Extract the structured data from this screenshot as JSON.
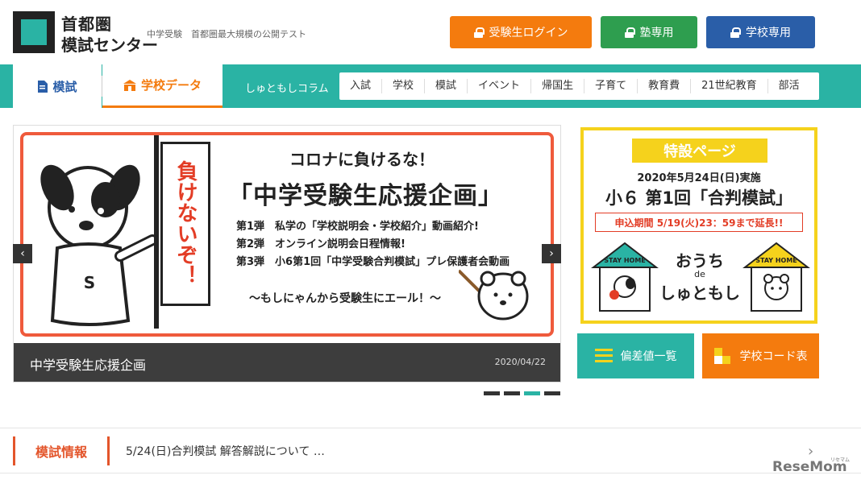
{
  "header": {
    "logo_line1": "首都圏",
    "logo_line2": "模試センター",
    "tagline": "中学受験　首都圏最大規模の公開テスト",
    "student_login": "受験生ログイン",
    "juku_only": "塾専用",
    "school_only": "学校専用"
  },
  "nav": {
    "tab_exam": "模試",
    "tab_school_data": "学校データ",
    "column_label": "しゅともしコラム",
    "categories": [
      "入試",
      "学校",
      "模試",
      "イベント",
      "帰国生",
      "子育て",
      "教育費",
      "21世紀教育",
      "部活"
    ]
  },
  "carousel": {
    "flag_text": "負けないぞ！",
    "line1": "コロナに負けるな！",
    "line2": "「中学受験生応援企画」",
    "sub1": "第1弾　私学の「学校説明会・学校紹介」動画紹介!",
    "sub2": "第2弾　オンライン説明会日程情報!",
    "sub3": "第3弾　小6第1回「中学受験合判模試」プレ保護者会動画",
    "line6": "～もしにゃんから受験生にエール！～",
    "dog_letter": "S",
    "caption_title": "中学受験生応援企画",
    "caption_date": "2020/04/22",
    "prev": "‹",
    "next": "›",
    "active_slide": 2,
    "slide_count": 4
  },
  "special": {
    "title": "特設ページ",
    "date": "2020年5月24日(日)実施",
    "name": "小６ 第1回「合判模試」",
    "deadline": "申込期間 5/19(火)23：59まで延長!!",
    "stay_home": "STAY HOME",
    "ouchi": "おうち",
    "de": "de",
    "shutomoshi": "しゅともし"
  },
  "buttons": {
    "hensachi": "偏差値一覧",
    "school_code": "学校コード表"
  },
  "news": {
    "label": "模試情報",
    "text": "5/24(日)合判模試 解答解説について …",
    "chevron": "›"
  },
  "watermark": {
    "brand": "ReseMom",
    "small": "リセマム"
  },
  "colors": {
    "teal": "#2ab3a4",
    "orange": "#f47b0e",
    "green": "#2e9e4f",
    "navy": "#2a5ea8",
    "red": "#e33d26",
    "yellow": "#f5d21c"
  }
}
